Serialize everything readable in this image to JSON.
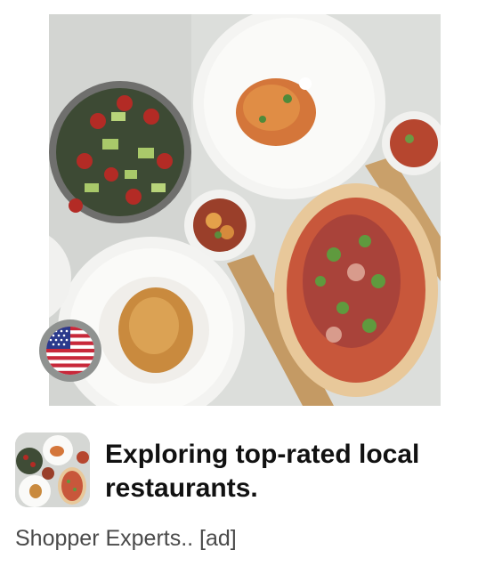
{
  "card": {
    "title": "Exploring top-rated local restaurants.",
    "source_text": "Shopper Experts.. [ad]"
  },
  "hero_image": {
    "subject": "food-spread-photo"
  },
  "badge": {
    "icon": "us-flag-icon"
  },
  "thumbnail": {
    "subject": "food-spread-thumbnail"
  }
}
